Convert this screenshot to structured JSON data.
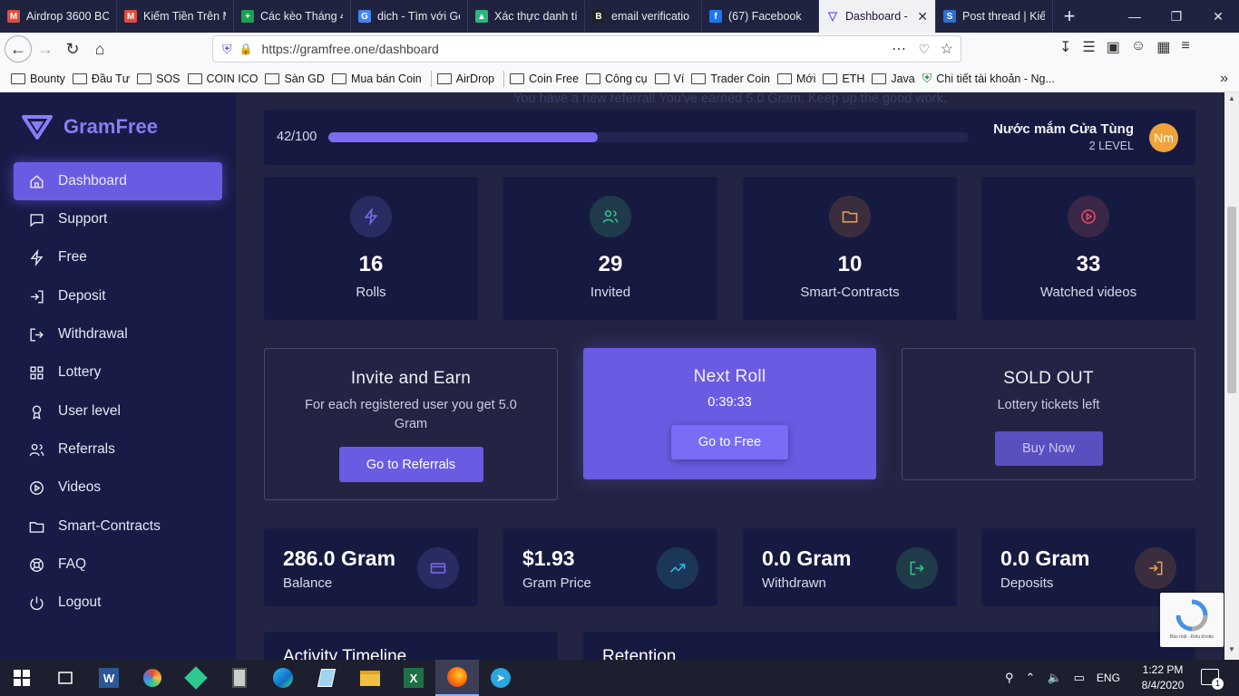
{
  "tabs": [
    {
      "title": "Airdrop 3600 BC",
      "color": "#e24b3b",
      "glyph": "M"
    },
    {
      "title": "Kiếm Tiền Trên M",
      "color": "#e24b3b",
      "glyph": "M"
    },
    {
      "title": "Các kèo Tháng 4",
      "color": "#1e9e50",
      "glyph": "+"
    },
    {
      "title": "dich - Tìm với Go",
      "color": "#4285f4",
      "glyph": "G"
    },
    {
      "title": "Xác thực danh tí",
      "color": "#2ab57d",
      "glyph": "▲"
    },
    {
      "title": "email verificatio",
      "color": "#222",
      "glyph": "B"
    },
    {
      "title": "(67) Facebook",
      "color": "#1877f2",
      "glyph": "f"
    },
    {
      "title": "Dashboard -",
      "color": "#6a5be3",
      "glyph": "▽"
    },
    {
      "title": "Post thread | Kiế",
      "color": "#2e6fd1",
      "glyph": "S"
    }
  ],
  "url": "https://gramfree.one/dashboard",
  "bookmarks": [
    "Bounty",
    "Đầu Tư",
    "SOS",
    "COIN ICO",
    "Sàn GD",
    "Mua bán Coin",
    "AirDrop",
    "Coin Free",
    "Công cụ",
    "Ví",
    "Trader Coin",
    "Mới",
    "ETH",
    "Java",
    "Chi tiết tài khoản - Ng..."
  ],
  "brand": "GramFree",
  "nav": [
    "Dashboard",
    "Support",
    "Free",
    "Deposit",
    "Withdrawal",
    "Lottery",
    "User level",
    "Referrals",
    "Videos",
    "Smart-Contracts",
    "FAQ",
    "Logout"
  ],
  "notice": "You have a new referral! You've earned 5.0 Gram. Keep up the good work.",
  "level": {
    "progress_text": "42/100",
    "progress": 0.42,
    "user": "Nước mắm Cửa Tùng",
    "level": "2 LEVEL",
    "avatar": "Nm"
  },
  "stats": [
    {
      "value": "16",
      "label": "Rolls",
      "icon": "bolt-icon",
      "color": "#7a6df0",
      "bg": "#292c60"
    },
    {
      "value": "29",
      "label": "Invited",
      "icon": "users-icon",
      "color": "#2ec98e",
      "bg": "#1f3a4a"
    },
    {
      "value": "10",
      "label": "Smart-Contracts",
      "icon": "folder-icon",
      "color": "#f0a050",
      "bg": "#3a2e3e"
    },
    {
      "value": "33",
      "label": "Watched videos",
      "icon": "play-circle-icon",
      "color": "#ee4b6a",
      "bg": "#3a2646"
    }
  ],
  "invite": {
    "title": "Invite and Earn",
    "desc": "For each registered user you get 5.0 Gram",
    "button": "Go to Referrals"
  },
  "roll": {
    "title": "Next Roll",
    "timer": "0:39:33",
    "button": "Go to Free"
  },
  "lottery": {
    "title": "SOLD OUT",
    "desc": "Lottery tickets left",
    "button": "Buy Now"
  },
  "balances": [
    {
      "value": "286.0 Gram",
      "label": "Balance",
      "icon": "card-icon",
      "color": "#7a6df0",
      "bg": "#292c60"
    },
    {
      "value": "$1.93",
      "label": "Gram Price",
      "icon": "trend-up-icon",
      "color": "#35b8e8",
      "bg": "#1c3658"
    },
    {
      "value": "0.0 Gram",
      "label": "Withdrawn",
      "icon": "logout-icon",
      "color": "#2ec98e",
      "bg": "#1f3a48"
    },
    {
      "value": "0.0 Gram",
      "label": "Deposits",
      "icon": "login-icon",
      "color": "#f0a050",
      "bg": "#3a2e3e"
    }
  ],
  "bottom_titles": [
    "Activity Timeline",
    "Retention"
  ],
  "recaptcha": "Bảo mật - Điều khoản",
  "taskbar": {
    "lang": "ENG",
    "time": "1:22 PM",
    "date": "8/4/2020",
    "notif": "1"
  }
}
